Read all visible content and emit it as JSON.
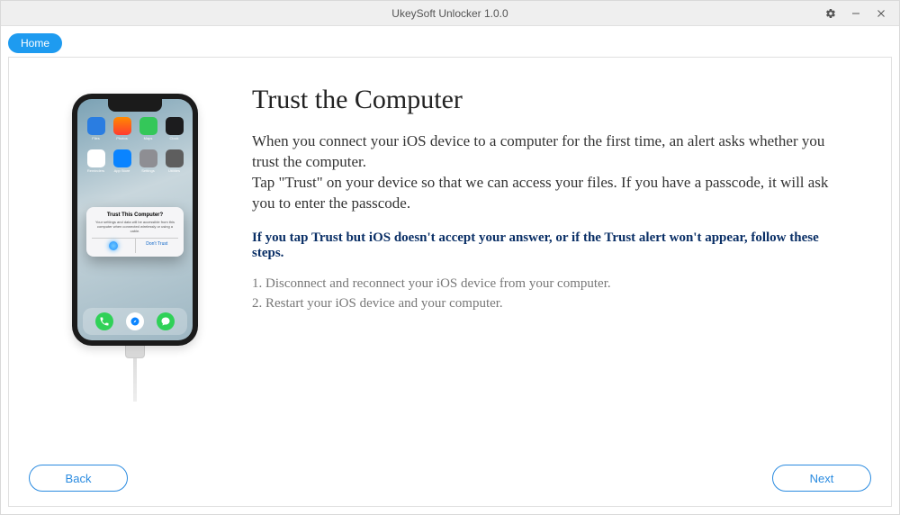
{
  "window": {
    "title": "UkeySoft Unlocker 1.0.0"
  },
  "nav": {
    "home": "Home"
  },
  "phone": {
    "apps_row1": [
      "Files",
      "Photos",
      "Maps",
      "Clock"
    ],
    "apps_row2": [
      "Reminders",
      "App Store",
      "Settings",
      "Utilities"
    ],
    "alert_title": "Trust This Computer?",
    "alert_body": "Your settings and data will be accessible from this computer when connected wirelessly or using a cable.",
    "alert_dont_trust": "Don't Trust"
  },
  "main": {
    "heading": "Trust the Computer",
    "para1": "When you connect your iOS device to a computer for the first time, an alert asks whether you trust the computer.",
    "para2": "Tap \"Trust\" on your device so that we can access your files. If you have a passcode, it will ask you to enter the passcode.",
    "note": "If you tap Trust but iOS doesn't accept your answer, or if the Trust alert won't appear, follow these steps.",
    "step1": "1. Disconnect and reconnect your iOS device from your computer.",
    "step2": "2. Restart your iOS device and your computer."
  },
  "footer": {
    "back": "Back",
    "next": "Next"
  },
  "colors": {
    "accent": "#1e9bf0",
    "btn_border": "#2a8be0",
    "note_color": "#0a2f66"
  }
}
